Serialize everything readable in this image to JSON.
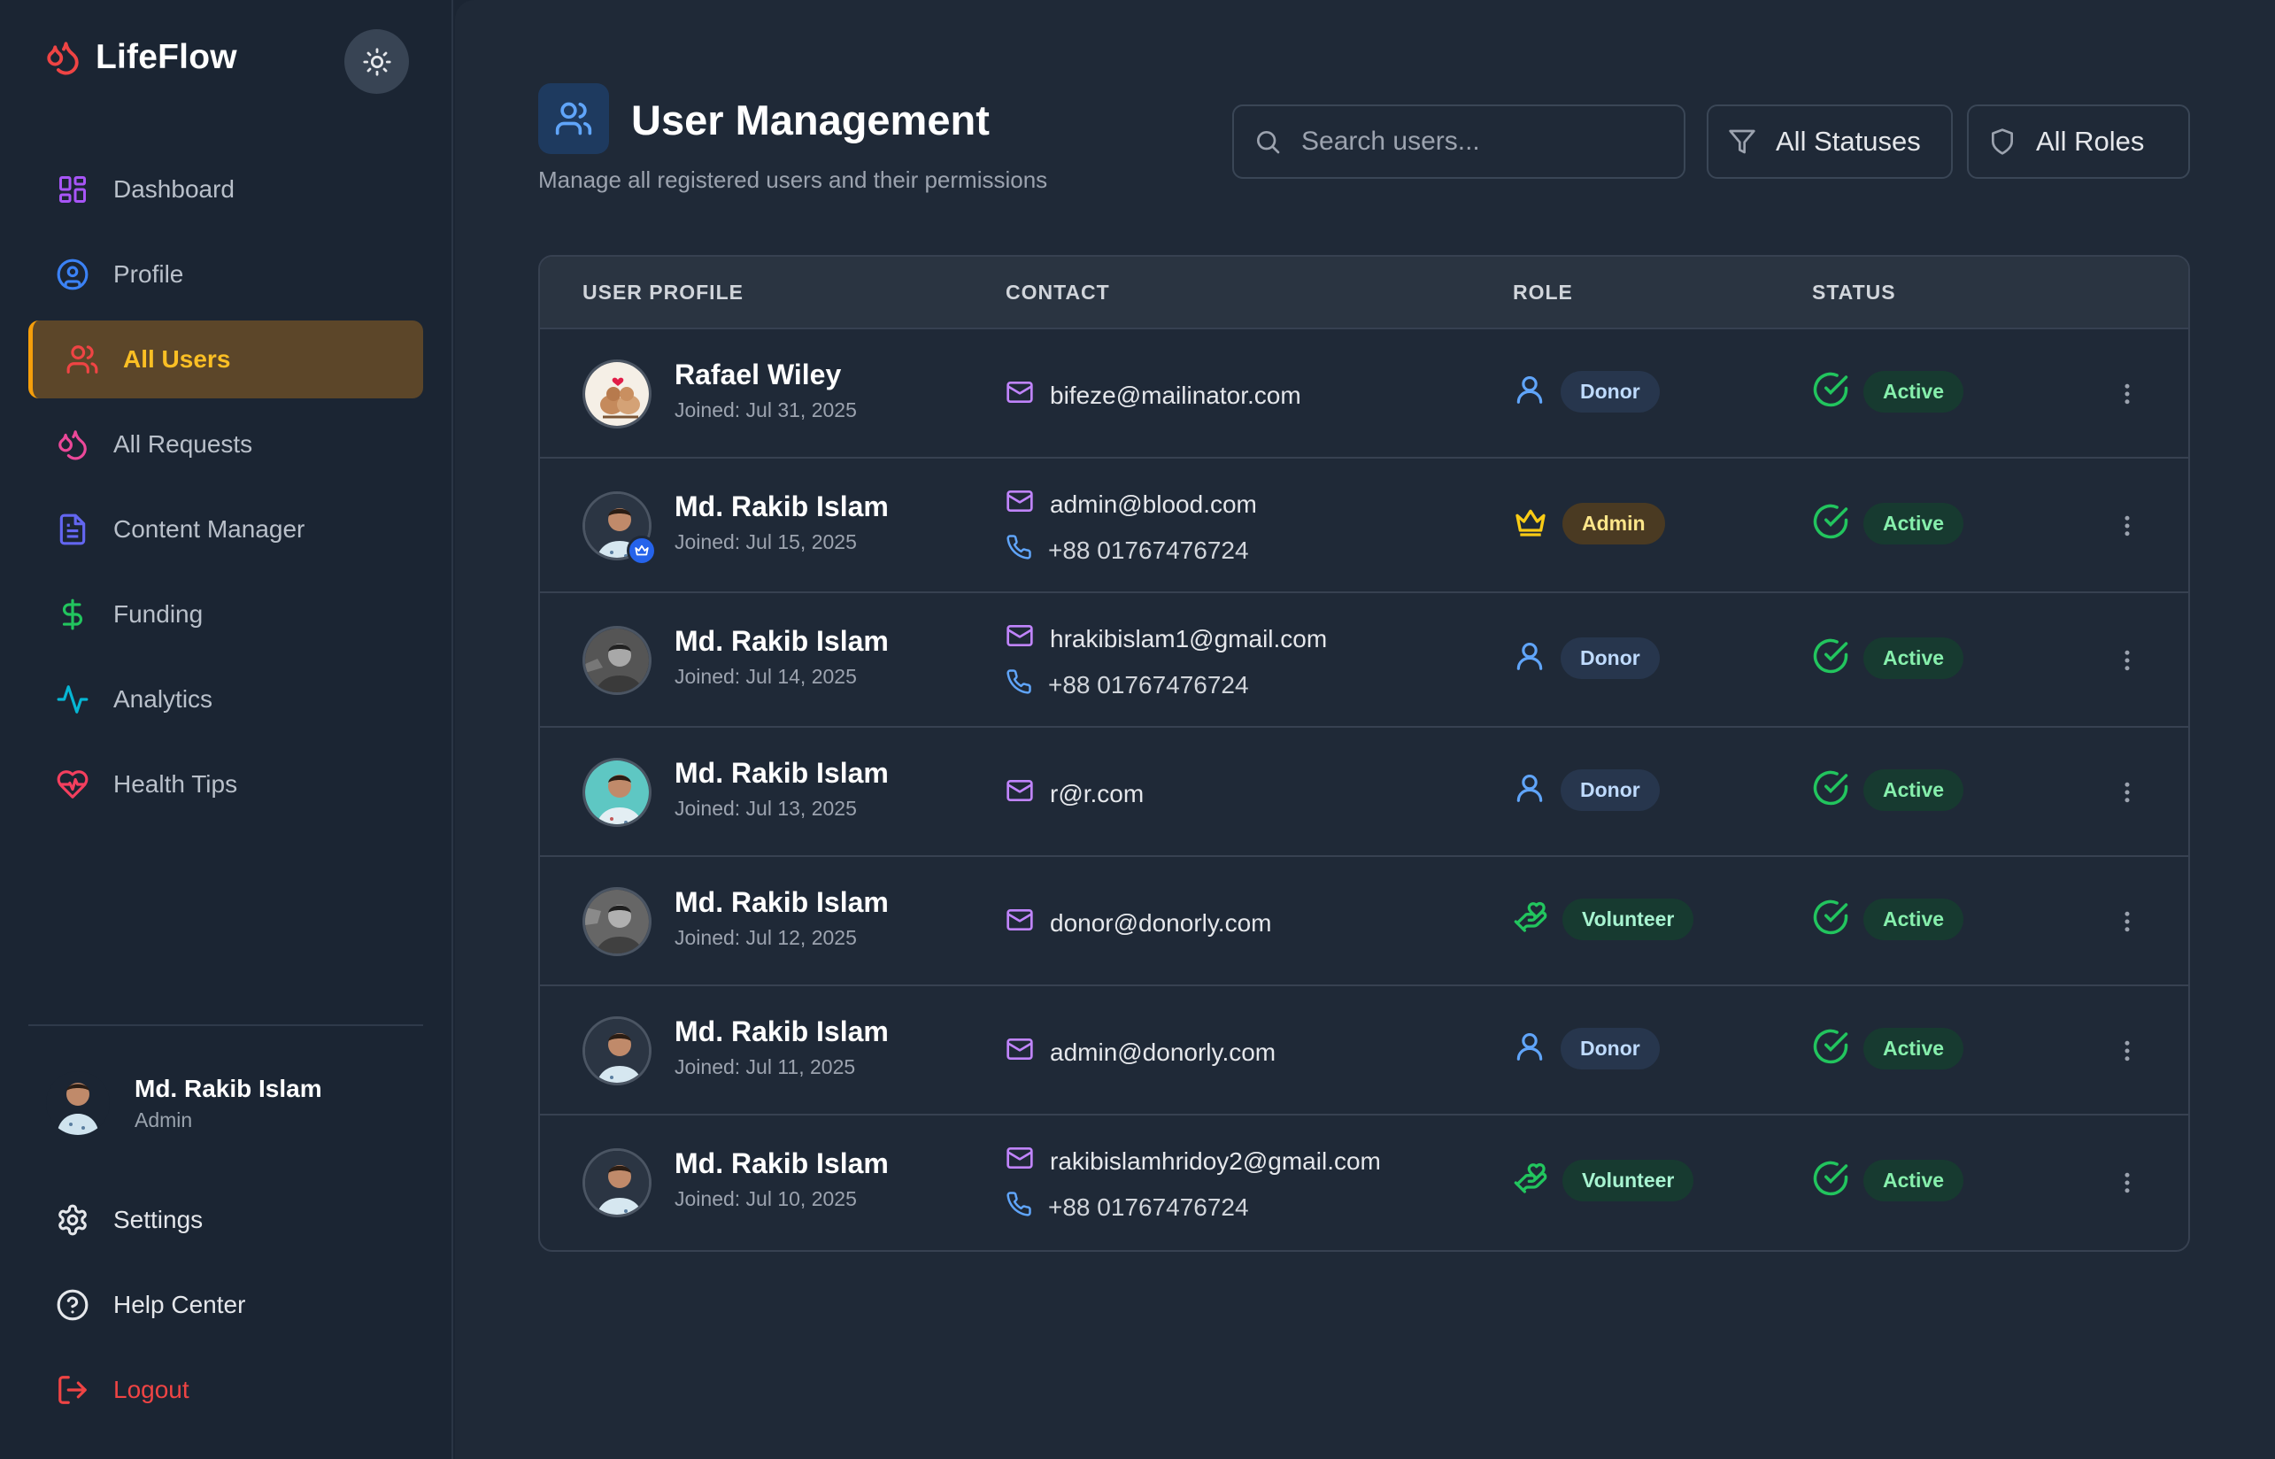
{
  "app": {
    "name": "LifeFlow"
  },
  "sidebar": {
    "items": [
      {
        "label": "Dashboard",
        "icon": "dashboard-grid-icon",
        "color": "#a855f7"
      },
      {
        "label": "Profile",
        "icon": "user-circle-icon",
        "color": "#3b82f6"
      },
      {
        "label": "All Users",
        "icon": "users-icon",
        "color": "#ef4444",
        "active": true
      },
      {
        "label": "All Requests",
        "icon": "blood-drops-icon",
        "color": "#ec4899"
      },
      {
        "label": "Content Manager",
        "icon": "document-icon",
        "color": "#6366f1"
      },
      {
        "label": "Funding",
        "icon": "dollar-icon",
        "color": "#22c55e"
      },
      {
        "label": "Analytics",
        "icon": "activity-icon",
        "color": "#06b6d4"
      },
      {
        "label": "Health Tips",
        "icon": "heart-pulse-icon",
        "color": "#f43f5e"
      }
    ],
    "user": {
      "name": "Md. Rakib Islam",
      "role": "Admin"
    },
    "bottom": [
      {
        "label": "Settings",
        "icon": "gear-icon"
      },
      {
        "label": "Help Center",
        "icon": "help-circle-icon"
      },
      {
        "label": "Logout",
        "icon": "logout-icon"
      }
    ]
  },
  "header": {
    "title": "User Management",
    "subtitle": "Manage all registered users and their permissions",
    "search_placeholder": "Search users...",
    "status_filter": "All Statuses",
    "role_filter": "All Roles"
  },
  "table": {
    "columns": [
      "USER PROFILE",
      "CONTACT",
      "ROLE",
      "STATUS"
    ],
    "rows": [
      {
        "name": "Rafael Wiley",
        "joined": "Joined: Jul 31, 2025",
        "email": "bifeze@mailinator.com",
        "phone": "",
        "role": "Donor",
        "status": "Active"
      },
      {
        "name": "Md. Rakib Islam",
        "joined": "Joined: Jul 15, 2025",
        "email": "admin@blood.com",
        "phone": "+88 01767476724",
        "role": "Admin",
        "status": "Active"
      },
      {
        "name": "Md. Rakib Islam",
        "joined": "Joined: Jul 14, 2025",
        "email": "hrakibislam1@gmail.com",
        "phone": "+88 01767476724",
        "role": "Donor",
        "status": "Active"
      },
      {
        "name": "Md. Rakib Islam",
        "joined": "Joined: Jul 13, 2025",
        "email": "r@r.com",
        "phone": "",
        "role": "Donor",
        "status": "Active"
      },
      {
        "name": "Md. Rakib Islam",
        "joined": "Joined: Jul 12, 2025",
        "email": "donor@donorly.com",
        "phone": "",
        "role": "Volunteer",
        "status": "Active"
      },
      {
        "name": "Md. Rakib Islam",
        "joined": "Joined: Jul 11, 2025",
        "email": "admin@donorly.com",
        "phone": "",
        "role": "Donor",
        "status": "Active"
      },
      {
        "name": "Md. Rakib Islam",
        "joined": "Joined: Jul 10, 2025",
        "email": "rakibislamhridoy2@gmail.com",
        "phone": "+88 01767476724",
        "role": "Volunteer",
        "status": "Active"
      }
    ]
  },
  "colors": {
    "accent": "#f59e0b",
    "active_bg": "#5c4629",
    "logout": "#ef4444",
    "mail": "#c084fc",
    "phone": "#60a5fa",
    "status_ok": "#22c55e"
  }
}
